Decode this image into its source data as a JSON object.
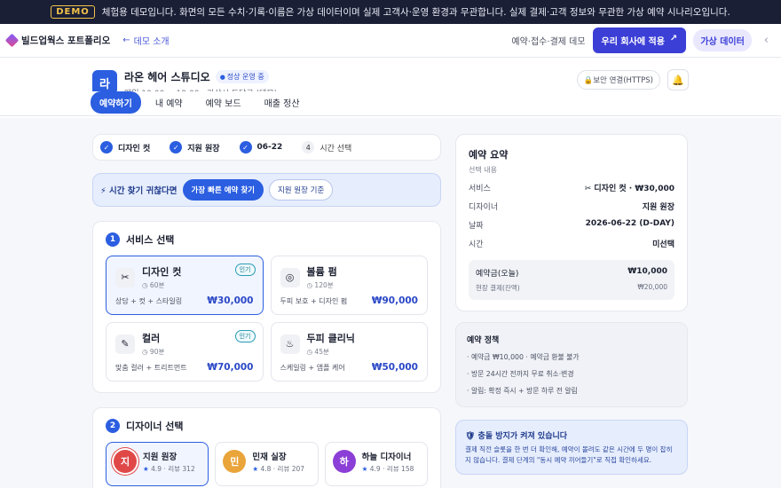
{
  "banner": {
    "tag": "DEMO",
    "text": "체험용 데모입니다. 화면의 모든 수치·기록·이름은 가상 데이터이며 실제 고객사·운영 환경과 무관합니다. 실제 결제·고객 정보와 무관한 가상 예약 시나리오입니다."
  },
  "nav": {
    "brand": "빌드업웍스 포트폴리오",
    "back": "데모 소개",
    "desc": "예약·접수·결제 데모",
    "cta": "우리 회사에 적용",
    "fake": "가상 데이터"
  },
  "shop": {
    "avatar": "라",
    "name": "라온 헤어 스튜디오",
    "status": "정상 운영 중",
    "hours": "매일 10:00 ~ 19:00 · 가상시 도담구 (데모)",
    "secure": "보안 연결(HTTPS)"
  },
  "tabs": [
    "예약하기",
    "내 예약",
    "예약 보드",
    "매출 정산"
  ],
  "steps": [
    {
      "label": "디자인 컷",
      "done": true
    },
    {
      "label": "지원 원장",
      "done": true
    },
    {
      "label": "06-22",
      "done": true
    },
    {
      "label": "시간 선택",
      "num": "4",
      "done": false
    }
  ],
  "quick": {
    "label": "⚡ 시간 찾기 귀찮다면",
    "fastest": "가장 빠른 예약 찾기",
    "by_designer": "지원 원장 기준"
  },
  "services": {
    "num": "1",
    "title": "서비스 선택",
    "items": [
      {
        "icon": "✂",
        "name": "디자인 컷",
        "duration": "◷ 60분",
        "desc": "상담 + 컷 + 스타일링",
        "price": "₩30,000",
        "hot": "인기"
      },
      {
        "icon": "◎",
        "name": "볼륨 펌",
        "duration": "◷ 120분",
        "desc": "두피 보호 + 디자인 펌",
        "price": "₩90,000",
        "hot": ""
      },
      {
        "icon": "✎",
        "name": "컬러",
        "duration": "◷ 90분",
        "desc": "맞춤 컬러 + 트리트먼트",
        "price": "₩70,000",
        "hot": "인기"
      },
      {
        "icon": "♨",
        "name": "두피 클리닉",
        "duration": "◷ 45분",
        "desc": "스케일링 + 앰플 케어",
        "price": "₩50,000",
        "hot": ""
      }
    ]
  },
  "designers": {
    "num": "2",
    "title": "디자이너 선택",
    "items": [
      {
        "initial": "지",
        "name": "지원 원장",
        "rating": "4.9",
        "reviews": "· 리뷰 312",
        "color": "#e04848"
      },
      {
        "initial": "민",
        "name": "민재 실장",
        "rating": "4.8",
        "reviews": "· 리뷰 207",
        "color": "#e9a43a"
      },
      {
        "initial": "하",
        "name": "하늘 디자이너",
        "rating": "4.9",
        "reviews": "· 리뷰 158",
        "color": "#8b3fd6"
      }
    ]
  },
  "summary": {
    "title": "예약 요약",
    "sub": "선택 내용",
    "rows": [
      {
        "k": "서비스",
        "v": "✂ 디자인 컷 · ₩30,000"
      },
      {
        "k": "디자이너",
        "v": "지원 원장"
      },
      {
        "k": "날짜",
        "v": "2026-06-22 (D-DAY)"
      },
      {
        "k": "시간",
        "v": "미선택"
      }
    ],
    "deposit_k": "예약금(오늘)",
    "deposit_v": "₩10,000",
    "onsite_k": "현장 결제(잔액)",
    "onsite_v": "₩20,000"
  },
  "policy": {
    "title": "예약 정책",
    "items": [
      "· 예약금 ₩10,000 · 예약금 환불 불가",
      "· 방문 24시간 전까지 무료 취소·변경",
      "· 알림: 확정 즉시 + 방문 하루 전 알림"
    ]
  },
  "warn": {
    "title": "🛡 충돌 방지가 켜져 있습니다",
    "body": "결제 직전 슬롯을 한 번 더 확인해, 예약이 몰려도 같은 시간에 두 명이 잡히지 않습니다. 결제 단계의 \"동시 예약 끼어들기\"로 직접 확인하세요."
  },
  "colors": {
    "accent": "#2b5ee0",
    "cta": "#3c3fd6",
    "banner": "#1a1f35"
  }
}
